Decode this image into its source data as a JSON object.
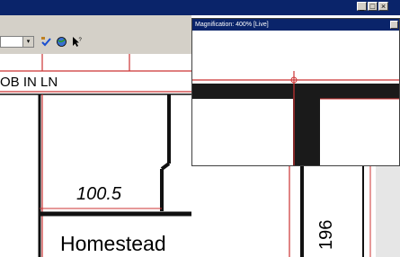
{
  "window": {
    "controls": {
      "minimize": "_",
      "maximize": "□",
      "close": "×"
    }
  },
  "toolbar": {
    "combo_arrow": "▾",
    "icons": [
      "checklist-icon",
      "globe-tool-icon",
      "help-pointer-icon"
    ]
  },
  "map": {
    "street_label": "OB IN LN",
    "lot_number": "100.5",
    "subdivision_label": "Homestead",
    "vertical_number": "196"
  },
  "magnifier": {
    "title": "Magnification: 400% [Live]"
  },
  "colors": {
    "titlebar": "#0a246a",
    "chrome": "#d4d0c8",
    "map_line_red": "#cc3333",
    "map_line_black": "#111111"
  }
}
